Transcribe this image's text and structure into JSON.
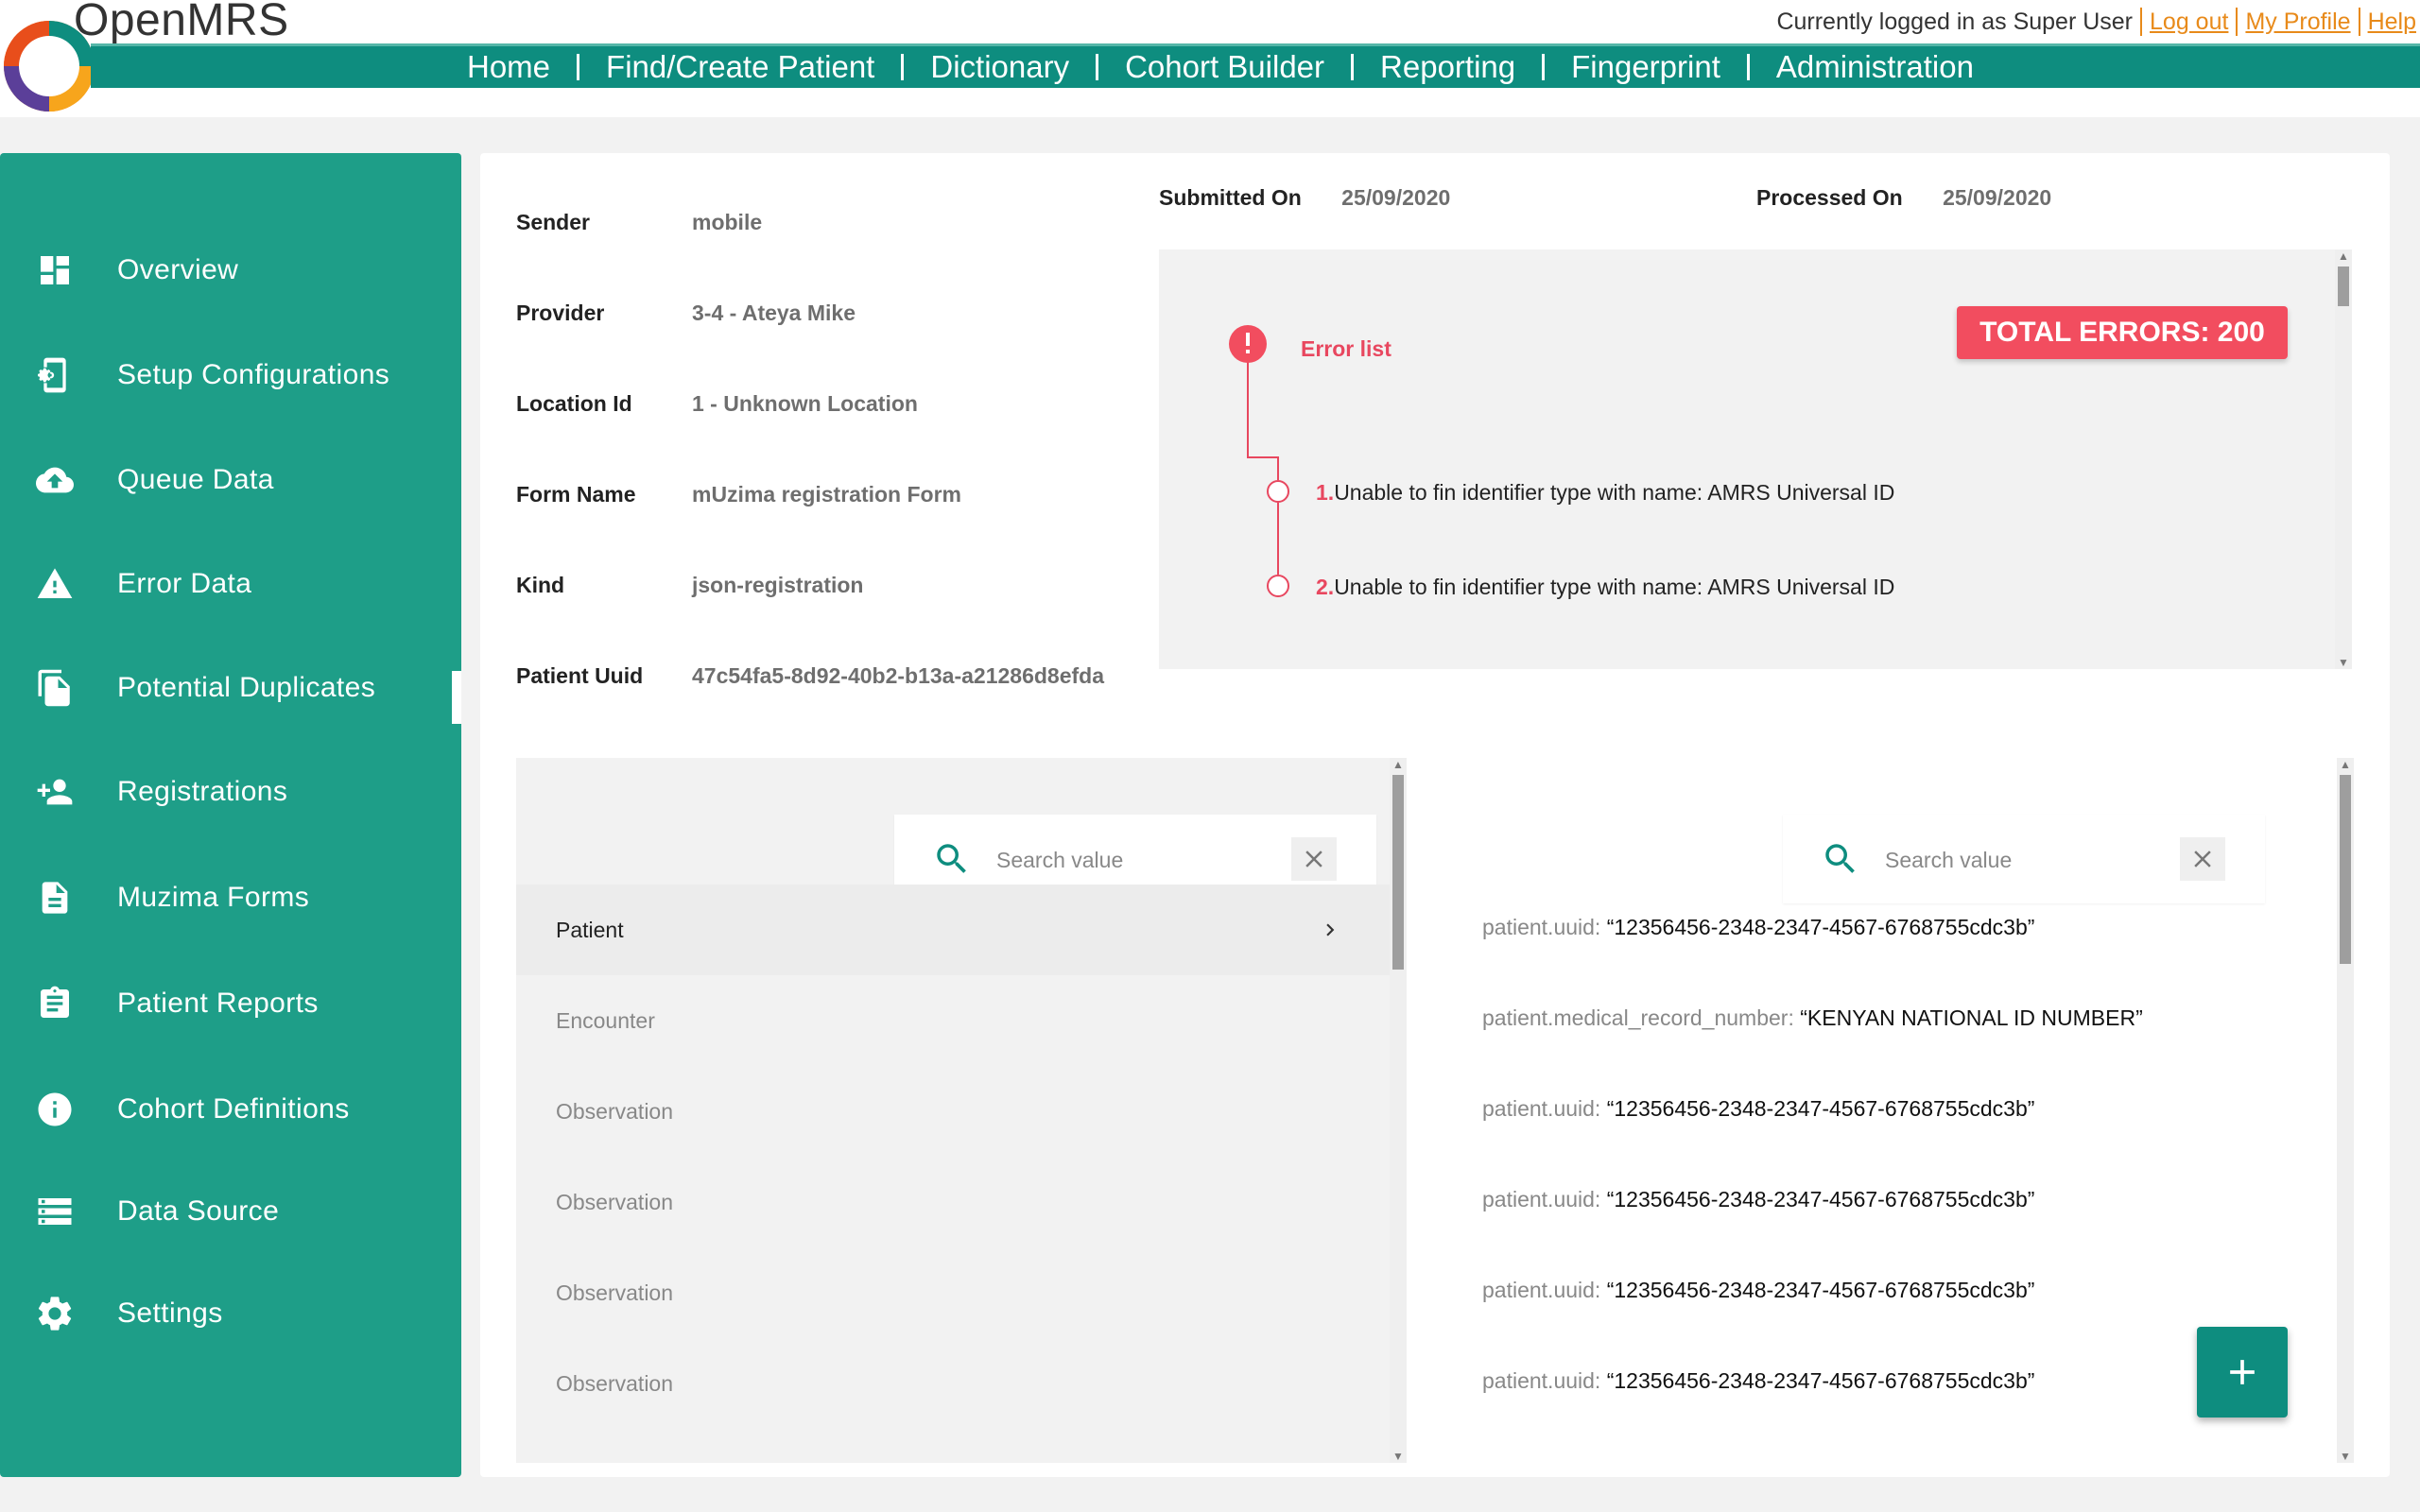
{
  "brand": {
    "name": "OpenMRS"
  },
  "userbar": {
    "logged_in_text": "Currently logged in as Super User",
    "logout": "Log out",
    "profile": "My Profile",
    "help": "Help"
  },
  "nav": [
    "Home",
    "Find/Create Patient",
    "Dictionary",
    "Cohort Builder",
    "Reporting",
    "Fingerprint",
    "Administration"
  ],
  "sidebar": {
    "items": [
      {
        "label": "Overview",
        "icon": "dashboard-icon"
      },
      {
        "label": "Setup Configurations",
        "icon": "settings-phone-icon"
      },
      {
        "label": "Queue Data",
        "icon": "cloud-upload-icon"
      },
      {
        "label": "Error Data",
        "icon": "warning-icon"
      },
      {
        "label": "Potential Duplicates",
        "icon": "duplicate-icon"
      },
      {
        "label": "Registrations",
        "icon": "add-person-icon"
      },
      {
        "label": "Muzima Forms",
        "icon": "document-icon"
      },
      {
        "label": "Patient Reports",
        "icon": "clipboard-icon"
      },
      {
        "label": "Cohort Definitions",
        "icon": "info-icon"
      },
      {
        "label": "Data Source",
        "icon": "storage-icon"
      },
      {
        "label": "Settings",
        "icon": "gear-icon"
      }
    ],
    "active": "Error Data"
  },
  "details": {
    "sender": {
      "label": "Sender",
      "value": "mobile"
    },
    "provider": {
      "label": "Provider",
      "value": "3-4 - Ateya Mike"
    },
    "location": {
      "label": "Location Id",
      "value": "1 - Unknown Location"
    },
    "form": {
      "label": "Form Name",
      "value": "mUzima registration Form"
    },
    "kind": {
      "label": "Kind",
      "value": "json-registration"
    },
    "patient_uuid": {
      "label": "Patient Uuid",
      "value": "47c54fa5-8d92-40b2-b13a-a21286d8efda"
    }
  },
  "meta": {
    "submitted": {
      "label": "Submitted On",
      "value": "25/09/2020"
    },
    "processed": {
      "label": "Processed On",
      "value": "25/09/2020"
    }
  },
  "errors": {
    "title": "Error list",
    "total": "TOTAL ERRORS: 200",
    "items": [
      {
        "num": "1.",
        "text": "Unable to fin identifier type with name: AMRS Universal ID"
      },
      {
        "num": "2.",
        "text": "Unable to fin identifier type with name: AMRS Universal ID"
      }
    ]
  },
  "left_search": {
    "placeholder": "Search value",
    "value": ""
  },
  "right_search": {
    "placeholder": "Search value",
    "value": ""
  },
  "tree": [
    "Patient",
    "Encounter",
    "Observation",
    "Observation",
    "Observation",
    "Observation"
  ],
  "tree_active": "Patient",
  "properties": [
    {
      "key": "patient.uuid: ",
      "value": "“12356456-2348-2347-4567-6768755cdc3b”"
    },
    {
      "key": "patient.medical_record_number: ",
      "value": "“KENYAN NATIONAL ID NUMBER”"
    },
    {
      "key": "patient.uuid: ",
      "value": "“12356456-2348-2347-4567-6768755cdc3b”"
    },
    {
      "key": "patient.uuid: ",
      "value": "“12356456-2348-2347-4567-6768755cdc3b”"
    },
    {
      "key": "patient.uuid: ",
      "value": "“12356456-2348-2347-4567-6768755cdc3b”"
    },
    {
      "key": "patient.uuid: ",
      "value": "“12356456-2348-2347-4567-6768755cdc3b”"
    }
  ],
  "colors": {
    "brand_teal": "#0e8d7f",
    "sidebar_green": "#1e9e88",
    "error_red": "#f24d5f",
    "link_orange": "#e88a1a"
  }
}
